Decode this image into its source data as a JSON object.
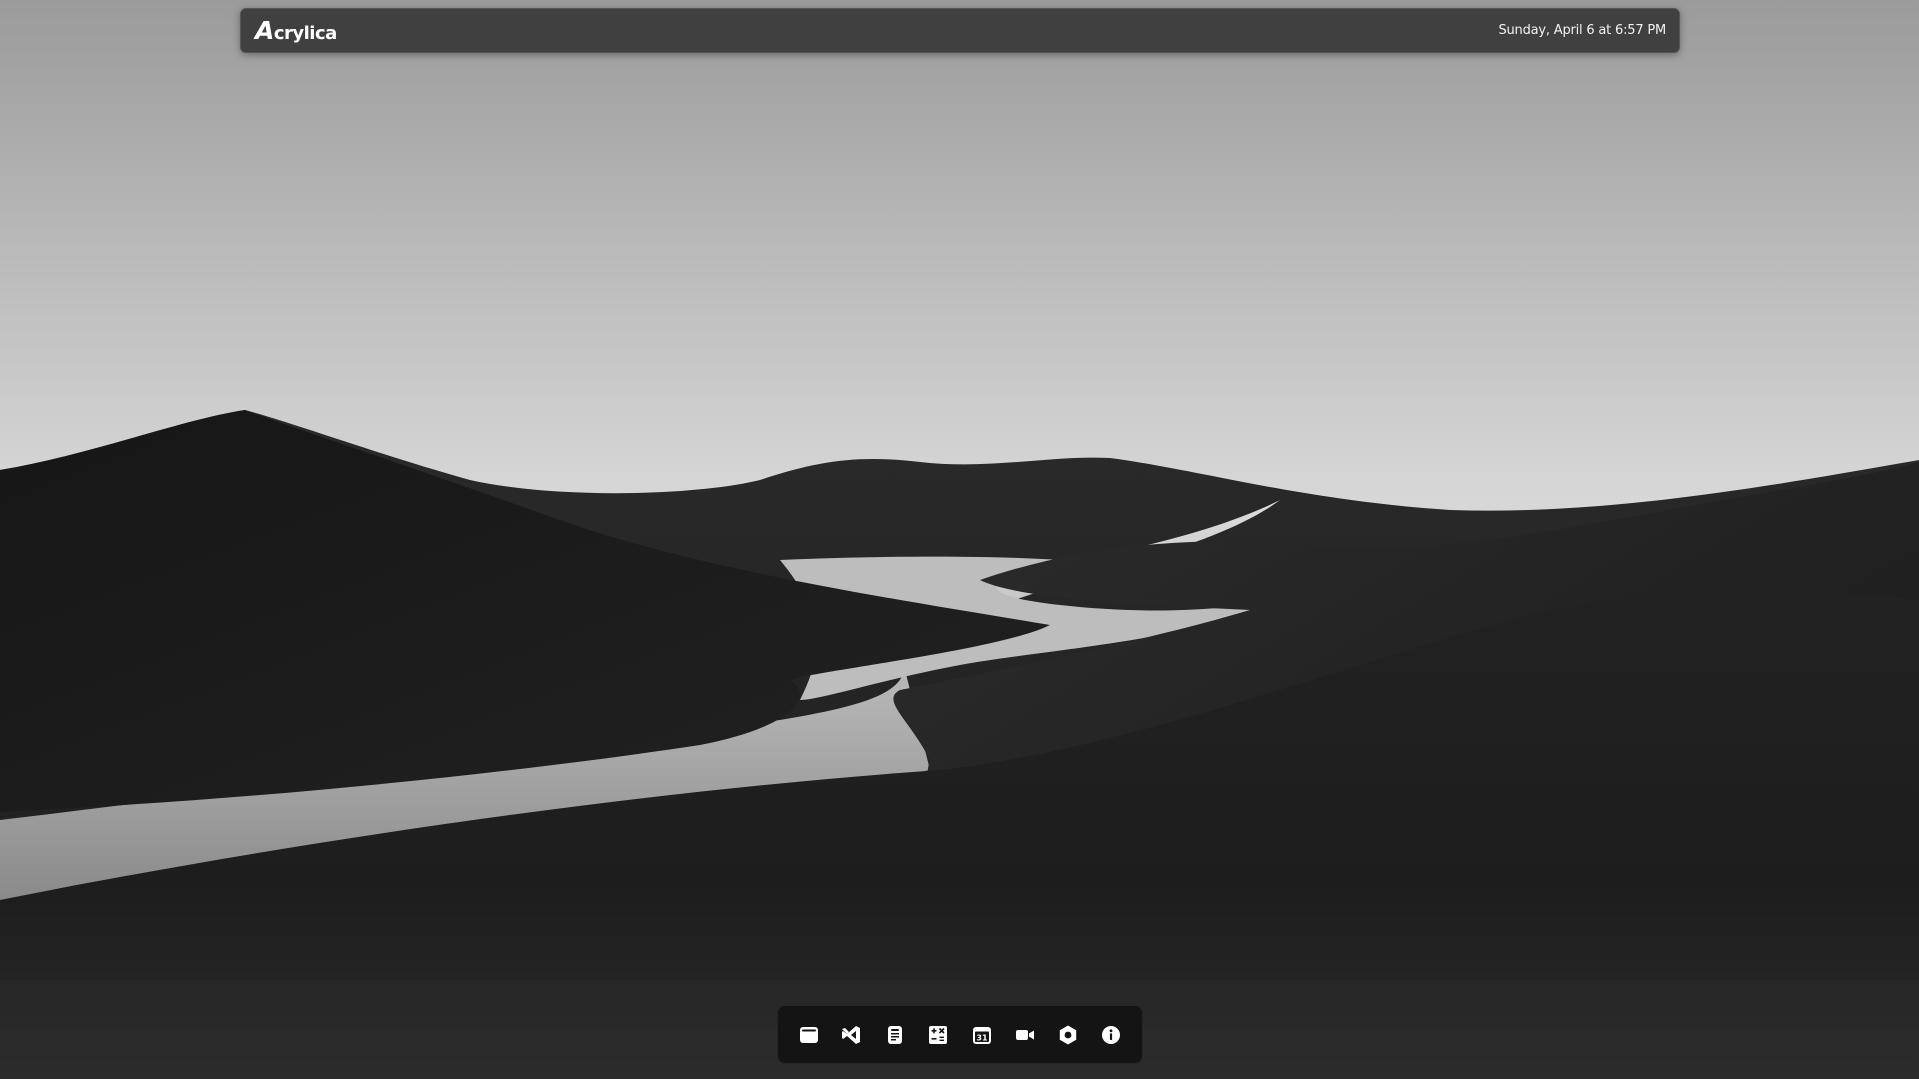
{
  "menubar": {
    "logo_mark": "A",
    "logo_rest": "crylica",
    "datetime": "Sunday, April 6 at 6:57 PM"
  },
  "dock": {
    "items": [
      {
        "icon": "window-icon"
      },
      {
        "icon": "code-editor-icon"
      },
      {
        "icon": "notes-icon"
      },
      {
        "icon": "calculator-icon"
      },
      {
        "icon": "calendar-icon",
        "day": "31"
      },
      {
        "icon": "video-camera-icon"
      },
      {
        "icon": "settings-icon"
      },
      {
        "icon": "info-icon"
      }
    ]
  },
  "colors": {
    "menubar_bg": "#404041",
    "dock_bg": "#141414",
    "icon": "#ffffff",
    "sky_top": "#9a9a9a",
    "sky_horizon": "#f5f5f5",
    "dune_dark": "#151515"
  }
}
